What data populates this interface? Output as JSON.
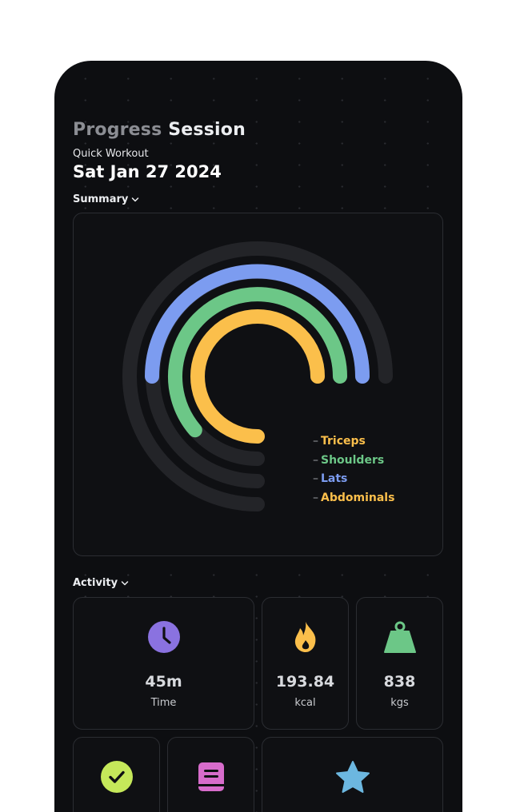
{
  "header": {
    "title_dim": "Progress",
    "title_bright": "Session",
    "subtitle": "Quick Workout",
    "date": "Sat Jan 27 2024"
  },
  "summary": {
    "heading": "Summary",
    "legend": [
      {
        "label": "Triceps",
        "color": "#fbbf4b"
      },
      {
        "label": "Shoulders",
        "color": "#6cc787"
      },
      {
        "label": "Lats",
        "color": "#7c9cf0"
      },
      {
        "label": "Abdominals",
        "color": "#fbbf4b"
      }
    ]
  },
  "activity": {
    "heading": "Activity",
    "stats": [
      {
        "value": "45m",
        "label": "Time",
        "icon": "clock-icon",
        "color": "#8a72e0"
      },
      {
        "value": "193.84",
        "label": "kcal",
        "icon": "flame-icon",
        "color": "#fbbf4b"
      },
      {
        "value": "838",
        "label": "kgs",
        "icon": "weight-icon",
        "color": "#6cc787"
      }
    ],
    "row2_icons": [
      {
        "icon": "check-icon",
        "color": "#c5e85a"
      },
      {
        "icon": "notes-icon",
        "color": "#d76ccb"
      },
      {
        "icon": "star-icon",
        "color": "#6cb7e0"
      }
    ]
  }
}
